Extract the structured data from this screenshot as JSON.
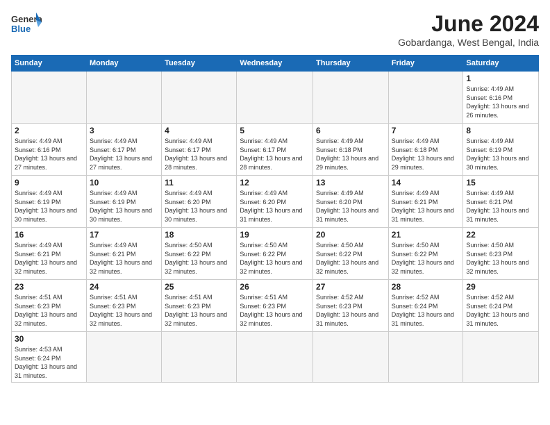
{
  "header": {
    "logo_general": "General",
    "logo_blue": "Blue",
    "month_title": "June 2024",
    "location": "Gobardanga, West Bengal, India"
  },
  "weekdays": [
    "Sunday",
    "Monday",
    "Tuesday",
    "Wednesday",
    "Thursday",
    "Friday",
    "Saturday"
  ],
  "weeks": [
    [
      {
        "day": "",
        "empty": true
      },
      {
        "day": "",
        "empty": true
      },
      {
        "day": "",
        "empty": true
      },
      {
        "day": "",
        "empty": true
      },
      {
        "day": "",
        "empty": true
      },
      {
        "day": "",
        "empty": true
      },
      {
        "day": "1",
        "sunrise": "4:49 AM",
        "sunset": "6:16 PM",
        "daylight": "13 hours and 26 minutes."
      }
    ],
    [
      {
        "day": "2",
        "sunrise": "4:49 AM",
        "sunset": "6:16 PM",
        "daylight": "13 hours and 27 minutes."
      },
      {
        "day": "3",
        "sunrise": "4:49 AM",
        "sunset": "6:17 PM",
        "daylight": "13 hours and 27 minutes."
      },
      {
        "day": "4",
        "sunrise": "4:49 AM",
        "sunset": "6:17 PM",
        "daylight": "13 hours and 28 minutes."
      },
      {
        "day": "5",
        "sunrise": "4:49 AM",
        "sunset": "6:17 PM",
        "daylight": "13 hours and 28 minutes."
      },
      {
        "day": "6",
        "sunrise": "4:49 AM",
        "sunset": "6:18 PM",
        "daylight": "13 hours and 29 minutes."
      },
      {
        "day": "7",
        "sunrise": "4:49 AM",
        "sunset": "6:18 PM",
        "daylight": "13 hours and 29 minutes."
      },
      {
        "day": "8",
        "sunrise": "4:49 AM",
        "sunset": "6:19 PM",
        "daylight": "13 hours and 30 minutes."
      }
    ],
    [
      {
        "day": "9",
        "sunrise": "4:49 AM",
        "sunset": "6:19 PM",
        "daylight": "13 hours and 30 minutes."
      },
      {
        "day": "10",
        "sunrise": "4:49 AM",
        "sunset": "6:19 PM",
        "daylight": "13 hours and 30 minutes."
      },
      {
        "day": "11",
        "sunrise": "4:49 AM",
        "sunset": "6:20 PM",
        "daylight": "13 hours and 30 minutes."
      },
      {
        "day": "12",
        "sunrise": "4:49 AM",
        "sunset": "6:20 PM",
        "daylight": "13 hours and 31 minutes."
      },
      {
        "day": "13",
        "sunrise": "4:49 AM",
        "sunset": "6:20 PM",
        "daylight": "13 hours and 31 minutes."
      },
      {
        "day": "14",
        "sunrise": "4:49 AM",
        "sunset": "6:21 PM",
        "daylight": "13 hours and 31 minutes."
      },
      {
        "day": "15",
        "sunrise": "4:49 AM",
        "sunset": "6:21 PM",
        "daylight": "13 hours and 31 minutes."
      }
    ],
    [
      {
        "day": "16",
        "sunrise": "4:49 AM",
        "sunset": "6:21 PM",
        "daylight": "13 hours and 32 minutes."
      },
      {
        "day": "17",
        "sunrise": "4:49 AM",
        "sunset": "6:21 PM",
        "daylight": "13 hours and 32 minutes."
      },
      {
        "day": "18",
        "sunrise": "4:50 AM",
        "sunset": "6:22 PM",
        "daylight": "13 hours and 32 minutes."
      },
      {
        "day": "19",
        "sunrise": "4:50 AM",
        "sunset": "6:22 PM",
        "daylight": "13 hours and 32 minutes."
      },
      {
        "day": "20",
        "sunrise": "4:50 AM",
        "sunset": "6:22 PM",
        "daylight": "13 hours and 32 minutes."
      },
      {
        "day": "21",
        "sunrise": "4:50 AM",
        "sunset": "6:22 PM",
        "daylight": "13 hours and 32 minutes."
      },
      {
        "day": "22",
        "sunrise": "4:50 AM",
        "sunset": "6:23 PM",
        "daylight": "13 hours and 32 minutes."
      }
    ],
    [
      {
        "day": "23",
        "sunrise": "4:51 AM",
        "sunset": "6:23 PM",
        "daylight": "13 hours and 32 minutes."
      },
      {
        "day": "24",
        "sunrise": "4:51 AM",
        "sunset": "6:23 PM",
        "daylight": "13 hours and 32 minutes."
      },
      {
        "day": "25",
        "sunrise": "4:51 AM",
        "sunset": "6:23 PM",
        "daylight": "13 hours and 32 minutes."
      },
      {
        "day": "26",
        "sunrise": "4:51 AM",
        "sunset": "6:23 PM",
        "daylight": "13 hours and 32 minutes."
      },
      {
        "day": "27",
        "sunrise": "4:52 AM",
        "sunset": "6:23 PM",
        "daylight": "13 hours and 31 minutes."
      },
      {
        "day": "28",
        "sunrise": "4:52 AM",
        "sunset": "6:24 PM",
        "daylight": "13 hours and 31 minutes."
      },
      {
        "day": "29",
        "sunrise": "4:52 AM",
        "sunset": "6:24 PM",
        "daylight": "13 hours and 31 minutes."
      }
    ],
    [
      {
        "day": "30",
        "sunrise": "4:53 AM",
        "sunset": "6:24 PM",
        "daylight": "13 hours and 31 minutes."
      },
      {
        "day": "",
        "empty": true
      },
      {
        "day": "",
        "empty": true
      },
      {
        "day": "",
        "empty": true
      },
      {
        "day": "",
        "empty": true
      },
      {
        "day": "",
        "empty": true
      },
      {
        "day": "",
        "empty": true
      }
    ]
  ]
}
